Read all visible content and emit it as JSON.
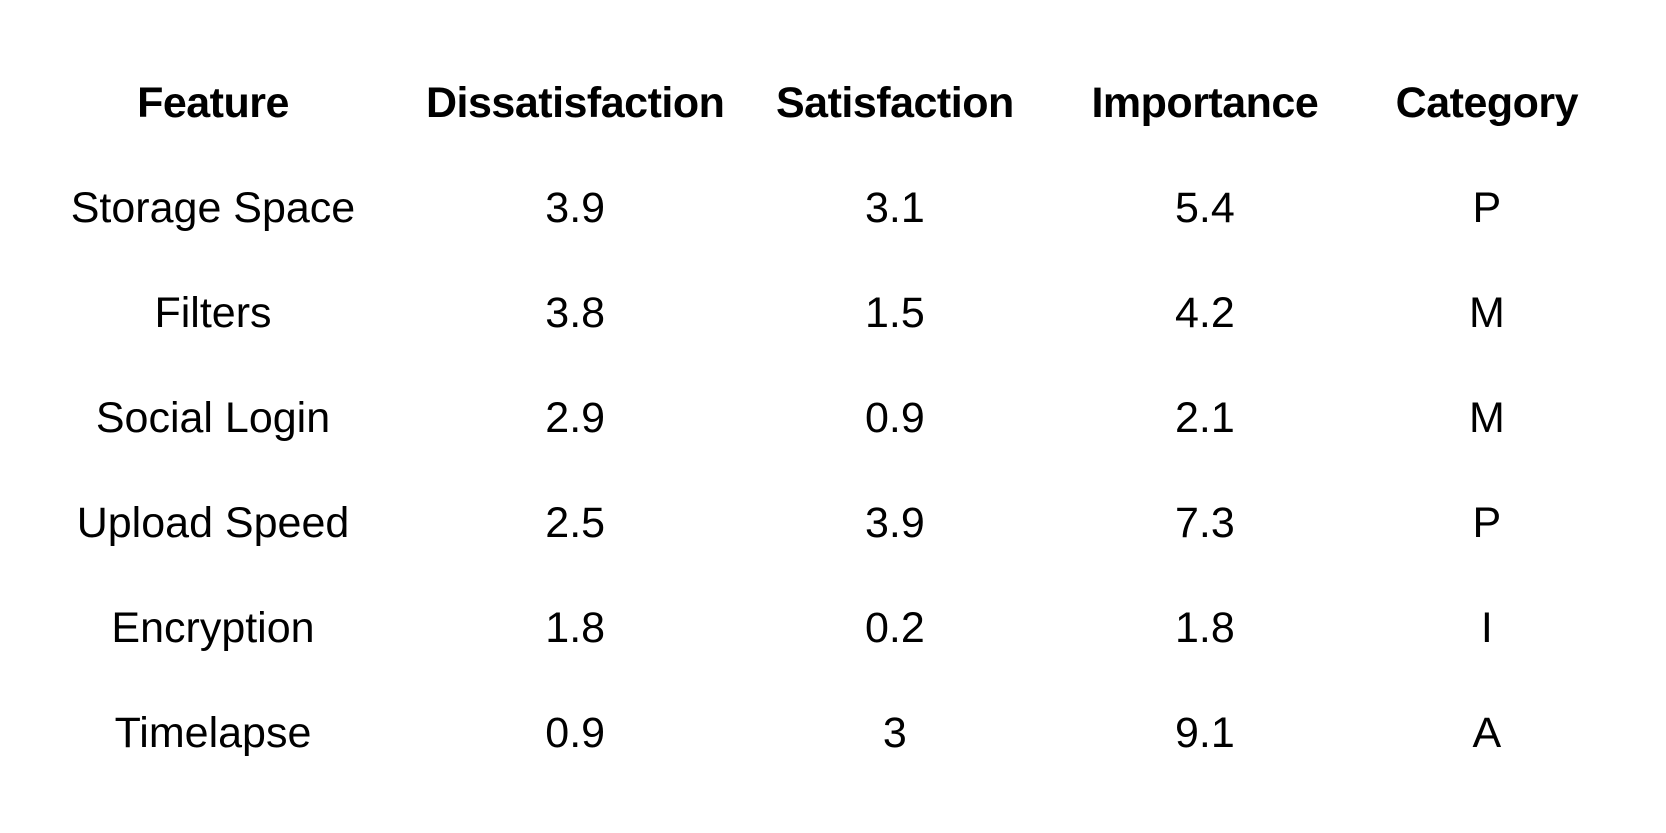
{
  "chart_data": {
    "type": "table",
    "title": "",
    "columns": [
      "Feature",
      "Dissatisfaction",
      "Satisfaction",
      "Importance",
      "Category"
    ],
    "rows": [
      [
        "Storage Space",
        "3.9",
        "3.1",
        "5.4",
        "P"
      ],
      [
        "Filters",
        "3.8",
        "1.5",
        "4.2",
        "M"
      ],
      [
        "Social Login",
        "2.9",
        "0.9",
        "2.1",
        "M"
      ],
      [
        "Upload Speed",
        "2.5",
        "3.9",
        "7.3",
        "P"
      ],
      [
        "Encryption",
        "1.8",
        "0.2",
        "1.8",
        "I"
      ],
      [
        "Timelapse",
        "0.9",
        "3",
        "9.1",
        "A"
      ]
    ]
  },
  "colors": {
    "text": "#000000",
    "background": "#ffffff"
  }
}
